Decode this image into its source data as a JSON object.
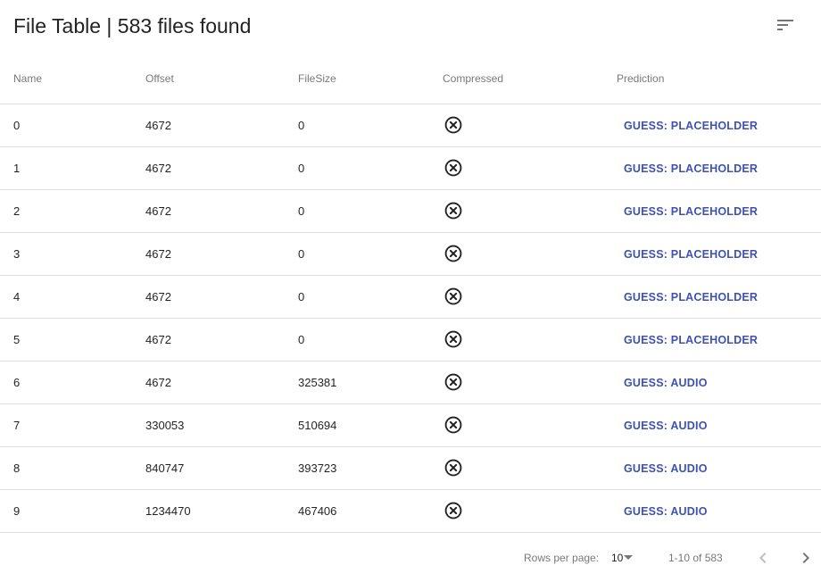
{
  "header": {
    "title": "File Table | 583 files found",
    "filter_icon": "filter-list-icon"
  },
  "table": {
    "columns": [
      "Name",
      "Offset",
      "FileSize",
      "Compressed",
      "Prediction"
    ],
    "rows": [
      {
        "name": "0",
        "offset": "4672",
        "filesize": "0",
        "compressed": false,
        "prediction": "GUESS: PLACEHOLDER"
      },
      {
        "name": "1",
        "offset": "4672",
        "filesize": "0",
        "compressed": false,
        "prediction": "GUESS: PLACEHOLDER"
      },
      {
        "name": "2",
        "offset": "4672",
        "filesize": "0",
        "compressed": false,
        "prediction": "GUESS: PLACEHOLDER"
      },
      {
        "name": "3",
        "offset": "4672",
        "filesize": "0",
        "compressed": false,
        "prediction": "GUESS: PLACEHOLDER"
      },
      {
        "name": "4",
        "offset": "4672",
        "filesize": "0",
        "compressed": false,
        "prediction": "GUESS: PLACEHOLDER"
      },
      {
        "name": "5",
        "offset": "4672",
        "filesize": "0",
        "compressed": false,
        "prediction": "GUESS: PLACEHOLDER"
      },
      {
        "name": "6",
        "offset": "4672",
        "filesize": "325381",
        "compressed": false,
        "prediction": "GUESS: AUDIO"
      },
      {
        "name": "7",
        "offset": "330053",
        "filesize": "510694",
        "compressed": false,
        "prediction": "GUESS: AUDIO"
      },
      {
        "name": "8",
        "offset": "840747",
        "filesize": "393723",
        "compressed": false,
        "prediction": "GUESS: AUDIO"
      },
      {
        "name": "9",
        "offset": "1234470",
        "filesize": "467406",
        "compressed": false,
        "prediction": "GUESS: AUDIO"
      }
    ],
    "compressed_icon": "cancel-circle-icon"
  },
  "pagination": {
    "rows_per_page_label": "Rows per page:",
    "rows_per_page_value": "10",
    "range_label": "1-10 of 583",
    "prev_icon": "chevron-left-icon",
    "next_icon": "chevron-right-icon"
  },
  "colors": {
    "accent": "#3f51b5",
    "divider": "#e0e0e0",
    "disabled_icon": "#bdbdbd"
  }
}
